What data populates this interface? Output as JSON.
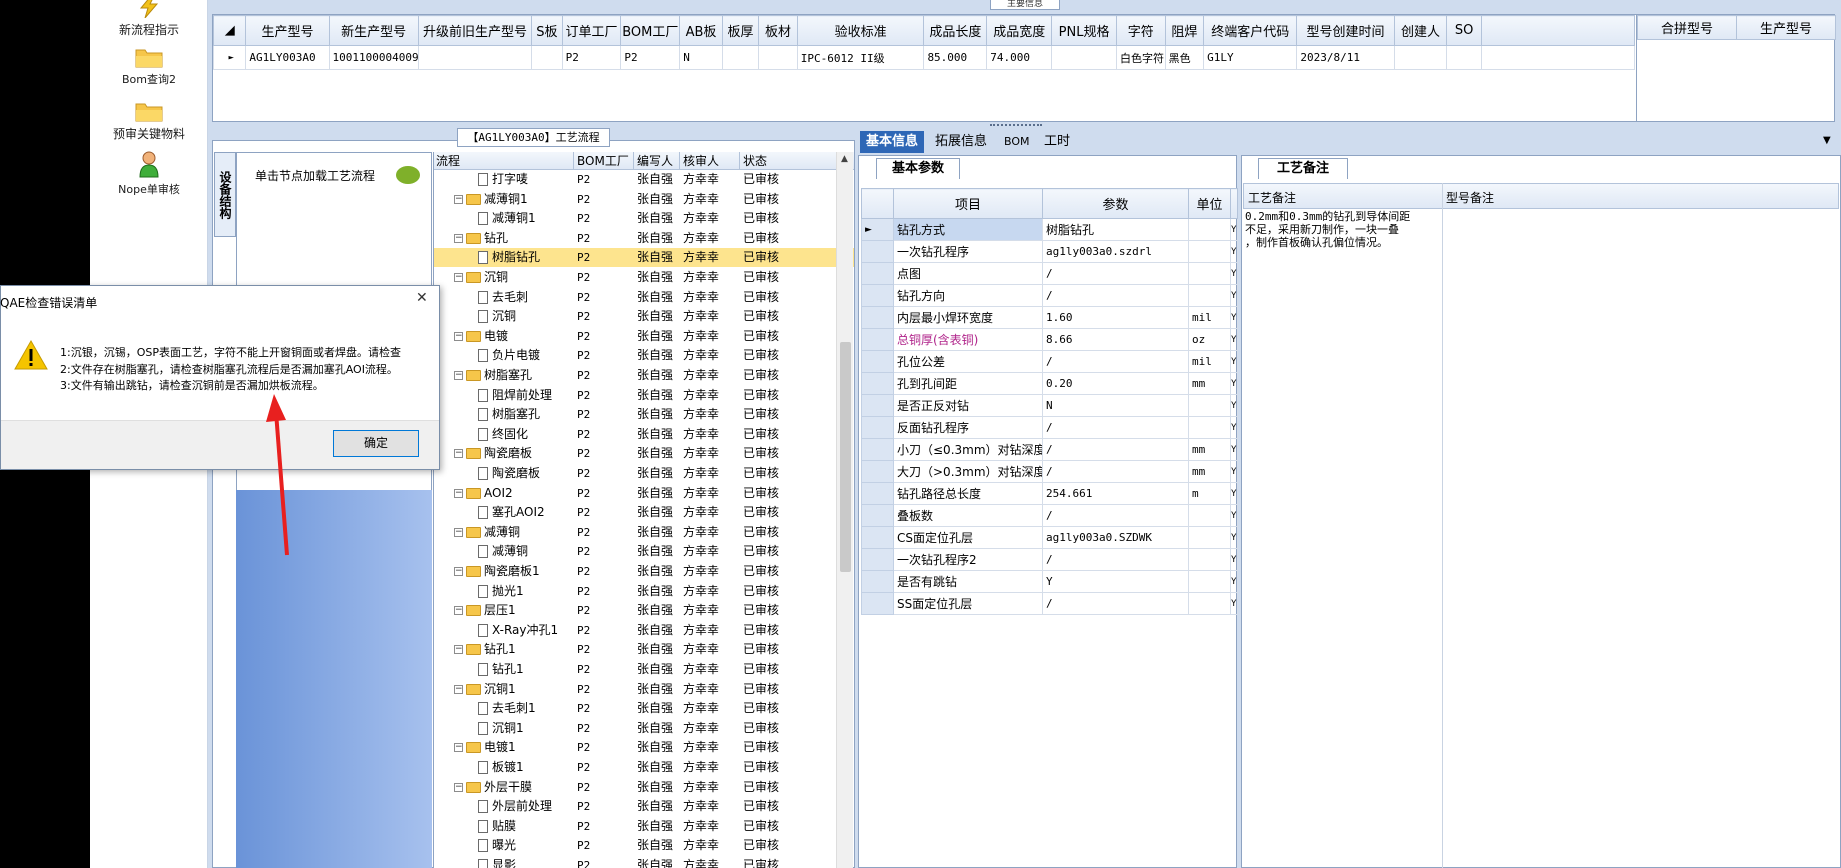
{
  "nav": [
    {
      "label": "新流程指示",
      "icon": "lightning-icon"
    },
    {
      "label": "Bom查询2",
      "icon": "folder-icon"
    },
    {
      "label": "预审关键物料",
      "icon": "folder-icon"
    },
    {
      "label": "Nope单审核",
      "icon": "user-icon"
    }
  ],
  "top_tab": "主要信息",
  "top_headers": [
    "生产型号",
    "新生产型号",
    "升级前旧生产型号",
    "S板",
    "订单工厂",
    "BOM工厂",
    "AB板",
    "板厚",
    "板材",
    "验收标准",
    "成品长度",
    "成品宽度",
    "PNL规格",
    "字符",
    "阻焊",
    "终端客户代码",
    "型号创建时间",
    "创建人",
    "SO"
  ],
  "top_row": [
    "AG1LY003A0",
    "10011000040090",
    "",
    "",
    "P2",
    "P2",
    "N",
    "",
    "",
    "IPC-6012 II级",
    "85.000",
    "74.000",
    "",
    "白色字符",
    "黑色",
    "G1LY",
    "2023/8/11",
    "",
    ""
  ],
  "side_headers": [
    "合拼型号",
    "生产型号"
  ],
  "flow_title": "【AG1LY003A0】工艺流程",
  "vtab": "设备结构",
  "node_hint": "单击节点加载工艺流程",
  "tree_headers": [
    "流程",
    "BOM工厂",
    "编写人",
    "核审人",
    "状态"
  ],
  "tree_rows": [
    {
      "name": "打字唛",
      "level": 1,
      "factory": "P2",
      "writer": "张自强",
      "checker": "方幸幸",
      "status": "已审核"
    },
    {
      "name": "减薄铜1",
      "level": 0,
      "factory": "P2",
      "writer": "张自强",
      "checker": "方幸幸",
      "status": "已审核"
    },
    {
      "name": "减薄铜1",
      "level": 1,
      "factory": "P2",
      "writer": "张自强",
      "checker": "方幸幸",
      "status": "已审核"
    },
    {
      "name": "钻孔",
      "level": 0,
      "factory": "P2",
      "writer": "张自强",
      "checker": "方幸幸",
      "status": "已审核"
    },
    {
      "name": "树脂钻孔",
      "level": 1,
      "factory": "P2",
      "writer": "张自强",
      "checker": "方幸幸",
      "status": "已审核",
      "selected": true
    },
    {
      "name": "沉铜",
      "level": 0,
      "factory": "P2",
      "writer": "张自强",
      "checker": "方幸幸",
      "status": "已审核"
    },
    {
      "name": "去毛刺",
      "level": 1,
      "factory": "P2",
      "writer": "张自强",
      "checker": "方幸幸",
      "status": "已审核"
    },
    {
      "name": "沉铜",
      "level": 1,
      "factory": "P2",
      "writer": "张自强",
      "checker": "方幸幸",
      "status": "已审核"
    },
    {
      "name": "电镀",
      "level": 0,
      "factory": "P2",
      "writer": "张自强",
      "checker": "方幸幸",
      "status": "已审核"
    },
    {
      "name": "负片电镀",
      "level": 1,
      "factory": "P2",
      "writer": "张自强",
      "checker": "方幸幸",
      "status": "已审核"
    },
    {
      "name": "树脂塞孔",
      "level": 0,
      "factory": "P2",
      "writer": "张自强",
      "checker": "方幸幸",
      "status": "已审核"
    },
    {
      "name": "阻焊前处理",
      "level": 1,
      "factory": "P2",
      "writer": "张自强",
      "checker": "方幸幸",
      "status": "已审核"
    },
    {
      "name": "树脂塞孔",
      "level": 1,
      "factory": "P2",
      "writer": "张自强",
      "checker": "方幸幸",
      "status": "已审核"
    },
    {
      "name": "终固化",
      "level": 1,
      "factory": "P2",
      "writer": "张自强",
      "checker": "方幸幸",
      "status": "已审核"
    },
    {
      "name": "陶瓷磨板",
      "level": 0,
      "factory": "P2",
      "writer": "张自强",
      "checker": "方幸幸",
      "status": "已审核"
    },
    {
      "name": "陶瓷磨板",
      "level": 1,
      "factory": "P2",
      "writer": "张自强",
      "checker": "方幸幸",
      "status": "已审核"
    },
    {
      "name": "AOI2",
      "level": 0,
      "factory": "P2",
      "writer": "张自强",
      "checker": "方幸幸",
      "status": "已审核"
    },
    {
      "name": "塞孔AOI2",
      "level": 1,
      "factory": "P2",
      "writer": "张自强",
      "checker": "方幸幸",
      "status": "已审核"
    },
    {
      "name": "减薄铜",
      "level": 0,
      "factory": "P2",
      "writer": "张自强",
      "checker": "方幸幸",
      "status": "已审核"
    },
    {
      "name": "减薄铜",
      "level": 1,
      "factory": "P2",
      "writer": "张自强",
      "checker": "方幸幸",
      "status": "已审核"
    },
    {
      "name": "陶瓷磨板1",
      "level": 0,
      "factory": "P2",
      "writer": "张自强",
      "checker": "方幸幸",
      "status": "已审核"
    },
    {
      "name": "抛光1",
      "level": 1,
      "factory": "P2",
      "writer": "张自强",
      "checker": "方幸幸",
      "status": "已审核"
    },
    {
      "name": "层压1",
      "level": 0,
      "factory": "P2",
      "writer": "张自强",
      "checker": "方幸幸",
      "status": "已审核"
    },
    {
      "name": "X-Ray冲孔1",
      "level": 1,
      "factory": "P2",
      "writer": "张自强",
      "checker": "方幸幸",
      "status": "已审核"
    },
    {
      "name": "钻孔1",
      "level": 0,
      "factory": "P2",
      "writer": "张自强",
      "checker": "方幸幸",
      "status": "已审核"
    },
    {
      "name": "钻孔1",
      "level": 1,
      "factory": "P2",
      "writer": "张自强",
      "checker": "方幸幸",
      "status": "已审核"
    },
    {
      "name": "沉铜1",
      "level": 0,
      "factory": "P2",
      "writer": "张自强",
      "checker": "方幸幸",
      "status": "已审核"
    },
    {
      "name": "去毛刺1",
      "level": 1,
      "factory": "P2",
      "writer": "张自强",
      "checker": "方幸幸",
      "status": "已审核"
    },
    {
      "name": "沉铜1",
      "level": 1,
      "factory": "P2",
      "writer": "张自强",
      "checker": "方幸幸",
      "status": "已审核"
    },
    {
      "name": "电镀1",
      "level": 0,
      "factory": "P2",
      "writer": "张自强",
      "checker": "方幸幸",
      "status": "已审核"
    },
    {
      "name": "板镀1",
      "level": 1,
      "factory": "P2",
      "writer": "张自强",
      "checker": "方幸幸",
      "status": "已审核"
    },
    {
      "name": "外层干膜",
      "level": 0,
      "factory": "P2",
      "writer": "张自强",
      "checker": "方幸幸",
      "status": "已审核"
    },
    {
      "name": "外层前处理",
      "level": 1,
      "factory": "P2",
      "writer": "张自强",
      "checker": "方幸幸",
      "status": "已审核"
    },
    {
      "name": "贴膜",
      "level": 1,
      "factory": "P2",
      "writer": "张自强",
      "checker": "方幸幸",
      "status": "已审核"
    },
    {
      "name": "曝光",
      "level": 1,
      "factory": "P2",
      "writer": "张自强",
      "checker": "方幸幸",
      "status": "已审核"
    },
    {
      "name": "显影",
      "level": 1,
      "factory": "P2",
      "writer": "张自强",
      "checker": "方幸幸",
      "status": "已审核"
    }
  ],
  "right_tabs": [
    "基本信息",
    "拓展信息",
    "BOM",
    "工时"
  ],
  "bp_tab": "基本参数",
  "bp_headers": [
    "项目",
    "参数",
    "单位"
  ],
  "bp_rows": [
    {
      "item": "钻孔方式",
      "value": "树脂钻孔",
      "unit": ""
    },
    {
      "item": "一次钻孔程序",
      "value": "ag1ly003a0.szdrl",
      "unit": ""
    },
    {
      "item": "点图",
      "value": "/",
      "unit": ""
    },
    {
      "item": "钻孔方向",
      "value": "/",
      "unit": ""
    },
    {
      "item": "内层最小焊环宽度",
      "value": "1.60",
      "unit": "mil"
    },
    {
      "item": "总铜厚(含表铜)",
      "value": "8.66",
      "unit": "oz",
      "highlight": true
    },
    {
      "item": "孔位公差",
      "value": "/",
      "unit": "mil"
    },
    {
      "item": "孔到孔间距",
      "value": "0.20",
      "unit": "mm"
    },
    {
      "item": "是否正反对钻",
      "value": "N",
      "unit": ""
    },
    {
      "item": "反面钻孔程序",
      "value": "/",
      "unit": ""
    },
    {
      "item": "小刀（≤0.3mm）对钻深度",
      "value": "/",
      "unit": "mm"
    },
    {
      "item": "大刀（>0.3mm）对钻深度",
      "value": "/",
      "unit": "mm"
    },
    {
      "item": "钻孔路径总长度",
      "value": "254.661",
      "unit": "m"
    },
    {
      "item": "叠板数",
      "value": "/",
      "unit": ""
    },
    {
      "item": "CS面定位孔层",
      "value": "ag1ly003a0.SZDWK",
      "unit": ""
    },
    {
      "item": "一次钻孔程序2",
      "value": "/",
      "unit": ""
    },
    {
      "item": "是否有跳钻",
      "value": "Y",
      "unit": ""
    },
    {
      "item": "SS面定位孔层",
      "value": "/",
      "unit": ""
    }
  ],
  "bp_extra_col": "Y",
  "rm_tab": "工艺备注",
  "rm_headers": [
    "工艺备注",
    "型号备注"
  ],
  "rm_text": "0.2mm和0.3mm的钻孔到导体间距\n不足，采用新刀制作，一块一叠\n，制作首板确认孔偏位情况。",
  "dialog": {
    "title": "QAE检查错误清单",
    "lines": [
      "1:沉银，沉锡，OSP表面工艺，字符不能上开窗铜面或者焊盘。请检查",
      "2:文件存在树脂塞孔，请检查树脂塞孔流程后是否漏加塞孔AOI流程。",
      "3:文件有输出跳钻，请检查沉铜前是否漏加烘板流程。"
    ],
    "ok": "确定",
    "close": "✕"
  },
  "colors": {
    "accent": "#2e67b6",
    "selected_row": "#fde48e",
    "arrow": "#e8201f",
    "warning": "#f5c400"
  }
}
